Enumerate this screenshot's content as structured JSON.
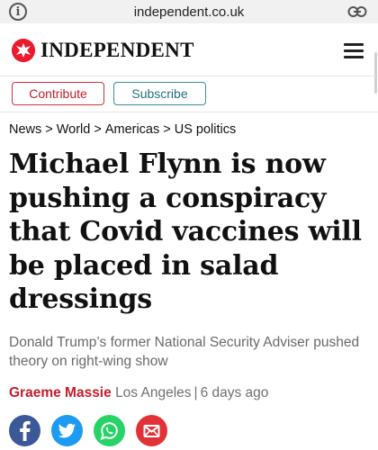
{
  "browser": {
    "domain": "independent.co.uk",
    "info_icon": "info-icon",
    "link_icon": "link-icon"
  },
  "masthead": {
    "logo_text": "INDEPENDENT",
    "logo_icon": "eagle-logo-icon",
    "menu_icon": "hamburger-menu-icon",
    "brand_color": "#ec1a2e"
  },
  "actions": {
    "contribute_label": "Contribute",
    "subscribe_label": "Subscribe"
  },
  "breadcrumb": {
    "items": [
      "News",
      "World",
      "Americas",
      "US politics"
    ],
    "separator": ">"
  },
  "article": {
    "headline": "Michael Flynn is now pushing a conspiracy that Covid vaccines will be placed in salad dressings",
    "standfirst": "Donald Trump’s former National Security Adviser pushed theory on right-wing show",
    "author": "Graeme Massie",
    "location": "Los Angeles",
    "byline_separator": "|",
    "time_ago": "6 days ago"
  },
  "share": {
    "icons": [
      "facebook-icon",
      "twitter-icon",
      "whatsapp-icon",
      "email-icon"
    ],
    "colors": {
      "facebook": "#3b5998",
      "twitter": "#1d9bf0",
      "whatsapp": "#25d366",
      "email": "#e1323a"
    }
  }
}
